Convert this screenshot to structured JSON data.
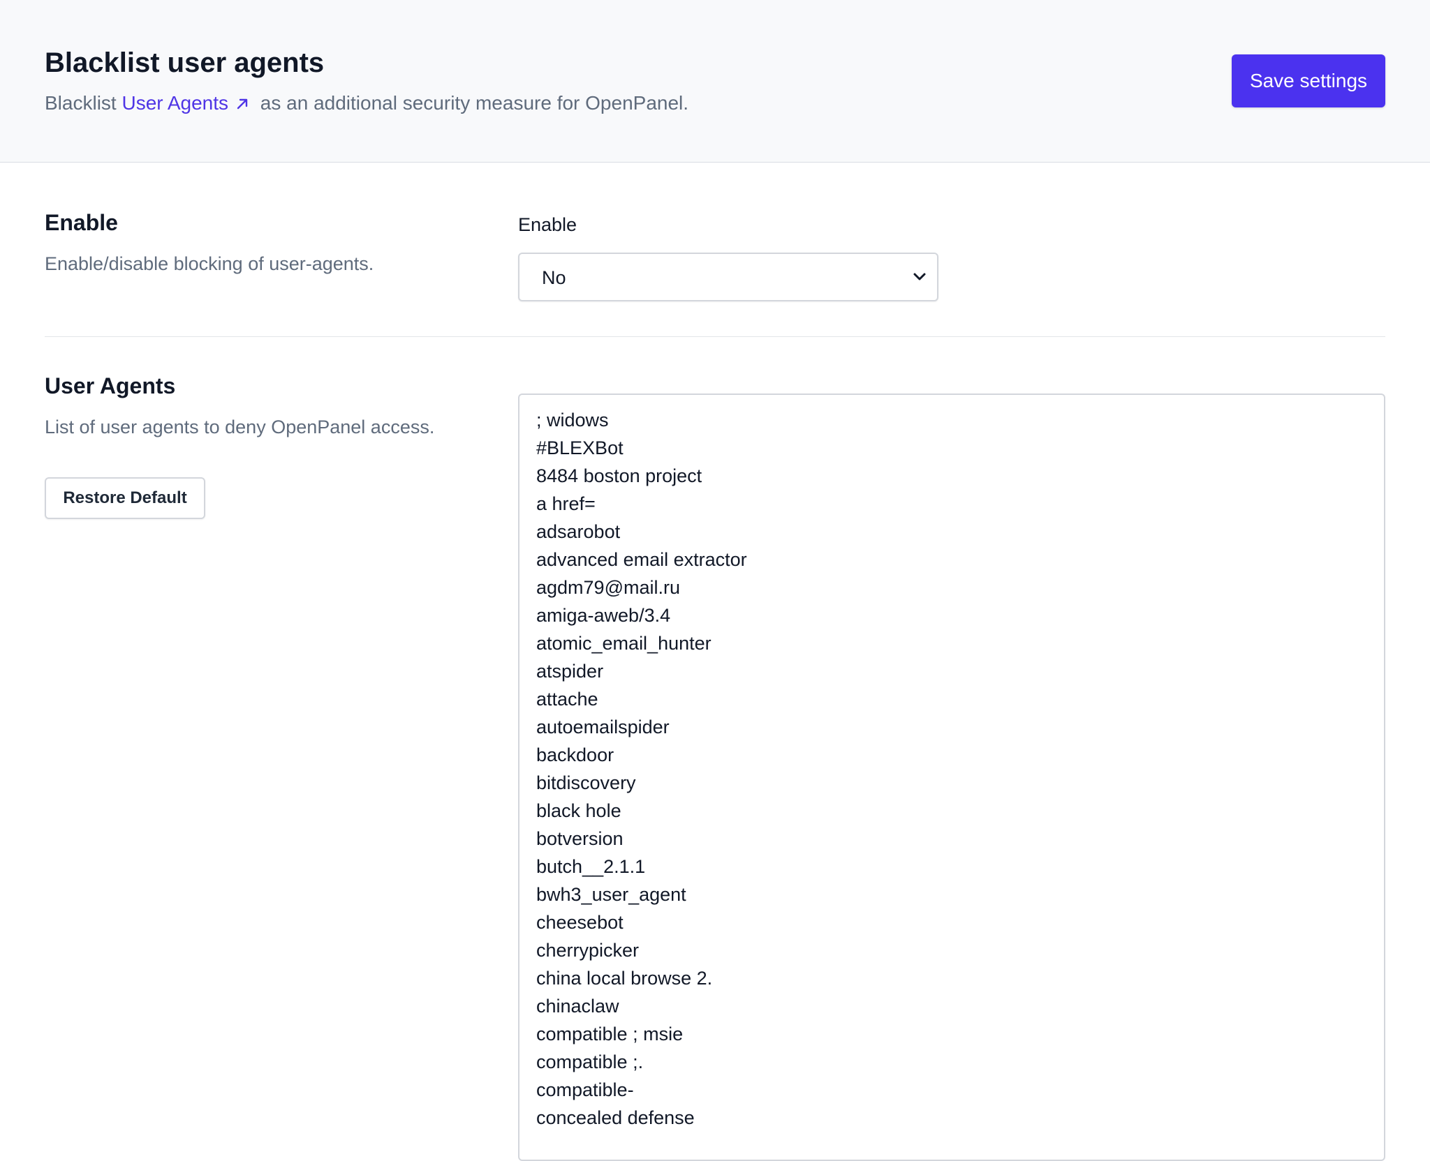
{
  "header": {
    "title": "Blacklist user agents",
    "subtitle_prefix": "Blacklist",
    "subtitle_link": "User Agents",
    "subtitle_suffix": "as an additional security measure for OpenPanel.",
    "save_label": "Save settings",
    "accent_color": "#4b32ef",
    "link_icon": "arrow-up-right-icon"
  },
  "enable_section": {
    "title": "Enable",
    "description": "Enable/disable blocking of user-agents.",
    "field_label": "Enable",
    "selected_value": "No",
    "select_icon": "chevron-down-icon"
  },
  "user_agents_section": {
    "title": "User Agents",
    "description": "List of user agents to deny OpenPanel access.",
    "restore_label": "Restore Default",
    "lines": [
      "; widows",
      "#BLEXBot",
      "8484 boston project",
      "a href=",
      "adsarobot",
      "advanced email extractor",
      "agdm79@mail.ru",
      "amiga-aweb/3.4",
      "atomic_email_hunter",
      "atspider",
      "attache",
      "autoemailspider",
      "backdoor",
      "bitdiscovery",
      "black hole",
      "botversion",
      "butch__2.1.1",
      "bwh3_user_agent",
      "cheesebot",
      "cherrypicker",
      "china local browse 2.",
      "chinaclaw",
      "compatible ; msie",
      "compatible ;.",
      "compatible-",
      "concealed defense"
    ]
  }
}
